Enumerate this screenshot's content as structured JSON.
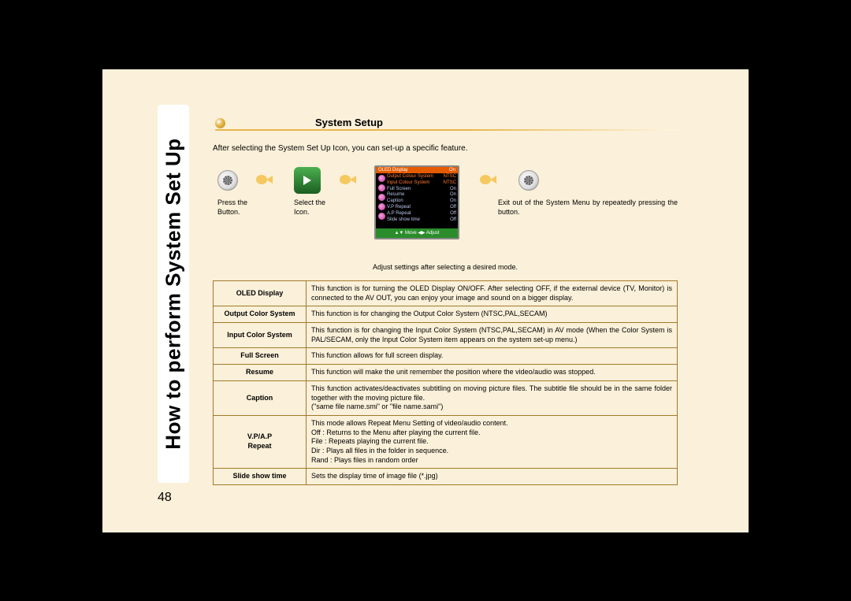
{
  "sidebar_title": "How to perform System Set Up",
  "page_number": "48",
  "header_title": "System Setup",
  "intro": "After selecting the System Set Up Icon, you can set-up a specific feature.",
  "steps": {
    "press_button": "Press the Button.",
    "select_icon": "Select the Icon.",
    "exit_text": "Exit out of the System Menu by repeatedly pressing the button."
  },
  "screen": {
    "title_left": "OLED Display",
    "title_right": "On",
    "rows": [
      {
        "label": "Output Colour System",
        "value": "NTSC",
        "hl": true
      },
      {
        "label": "Input Colour System",
        "value": "NTSC",
        "hl": true
      },
      {
        "label": "Full Screen",
        "value": "On",
        "hl": false
      },
      {
        "label": "Resume",
        "value": "On",
        "hl": false
      },
      {
        "label": "Caption",
        "value": "On",
        "hl": false
      },
      {
        "label": "V.P Repeat",
        "value": "Off",
        "hl": false
      },
      {
        "label": "A.P Repeat",
        "value": "Off",
        "hl": false
      },
      {
        "label": "Slide show time",
        "value": "Off",
        "hl": false
      }
    ],
    "footer": "▲▼ Move   ◀▶ Adjust"
  },
  "adjust_caption": "Adjust settings after selecting a desired mode.",
  "features": [
    {
      "label": "OLED Display",
      "desc": "This function is for turning the OLED Display ON/OFF.  After selecting OFF, if the external device (TV, Monitor) is connected to the AV OUT, you can enjoy your image and sound on a bigger display."
    },
    {
      "label": "Output Color System",
      "desc": "This function is for changing the Output Color System (NTSC,PAL,SECAM)"
    },
    {
      "label": "Input Color System",
      "desc": "This function is for changing the Input Color System (NTSC,PAL,SECAM) in AV mode (When the Color System is PAL/SECAM, only the Input Color System item appears on the system set-up menu.)"
    },
    {
      "label": "Full Screen",
      "desc": "This function allows for full screen display."
    },
    {
      "label": "Resume",
      "desc": "This function will make the unit remember the position where the video/audio was stopped."
    },
    {
      "label": "Caption",
      "desc": "This function activates/deactivates subtitling on moving picture files.  The subtitle file should be in the same folder together with the moving picture file.\n(\"same file name.smi\" or \"file name.sami\")"
    },
    {
      "label": "V.P/A.P\nRepeat",
      "desc": "This mode allows Repeat Menu Setting of video/audio content.\nOff : Returns to the Menu after playing the current file.\nFile : Repeats playing the current file.\nDir : Plays all files in the folder in sequence.\nRand : Plays files in random order"
    },
    {
      "label": "Slide show time",
      "desc": "Sets the display time of image file (*.jpg)"
    }
  ]
}
